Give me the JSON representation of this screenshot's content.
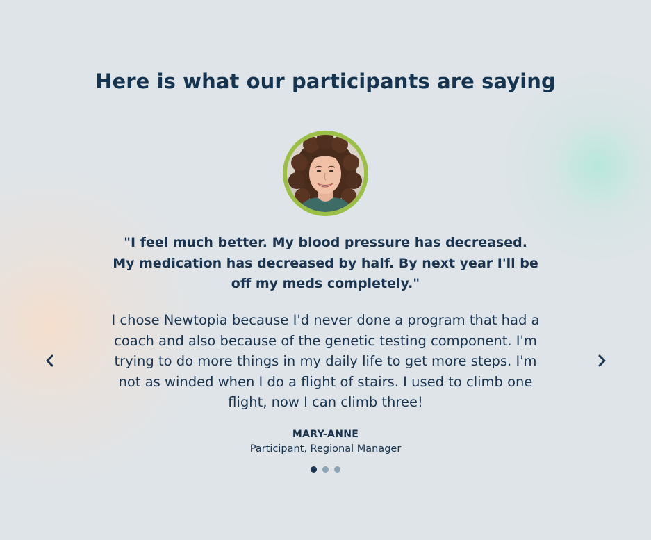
{
  "section": {
    "title": "Here is what our participants are saying"
  },
  "testimonial": {
    "avatar_alt": "Mary-Anne portrait photo",
    "avatar_ring_color": "#9cbf45",
    "quote": "\"I feel much better. My blood pressure has decreased. My medication has decreased by half. By next year I'll be off my meds completely.\"",
    "story": "I chose Newtopia because I'd never done a program that had a coach and also because of the genetic testing component. I'm trying to do more things in my daily life to get more steps. I'm not as winded when I do a flight of stairs. I used to climb one flight, now I can climb three!",
    "author_name": "MARY-ANNE",
    "author_role": "Participant, Regional Manager"
  },
  "carousel": {
    "prev_icon": "chevron-left-icon",
    "next_icon": "chevron-right-icon",
    "active_index": 0,
    "slide_count": 3
  },
  "colors": {
    "text": "#1b3550",
    "dot_active": "#1b3550",
    "dot_inactive": "#8fa4b2",
    "background": "#dfe4e8"
  }
}
